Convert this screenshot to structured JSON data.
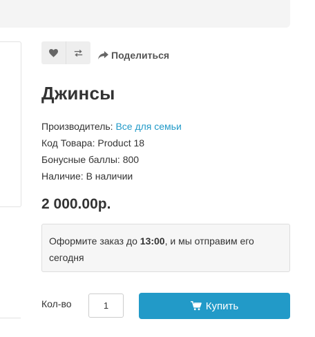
{
  "product": {
    "title": "Джинсы",
    "specs": {
      "manufacturer_label": "Производитель:",
      "manufacturer_value": "Все для семьи",
      "code_label": "Код Товара:",
      "code_value": "Product 18",
      "bonus_label": "Бонусные баллы:",
      "bonus_value": "800",
      "stock_label": "Наличие:",
      "stock_value": "В наличии"
    },
    "price": "2 000.00р."
  },
  "actions": {
    "wishlist_icon": "heart-icon",
    "compare_icon": "compare-arrows-icon",
    "share_label": "Поделиться",
    "share_icon": "share-arrow-icon"
  },
  "notice": {
    "text_before": "Оформите заказ до ",
    "time": "13:00",
    "text_after": ", и мы отправим его сегодня"
  },
  "cart": {
    "qty_label": "Кол-во",
    "qty_value": "1",
    "buy_label": "Купить",
    "buy_icon": "cart-icon"
  },
  "colors": {
    "accent": "#229ac8",
    "text": "#333333",
    "panel": "#f4f4f4"
  }
}
